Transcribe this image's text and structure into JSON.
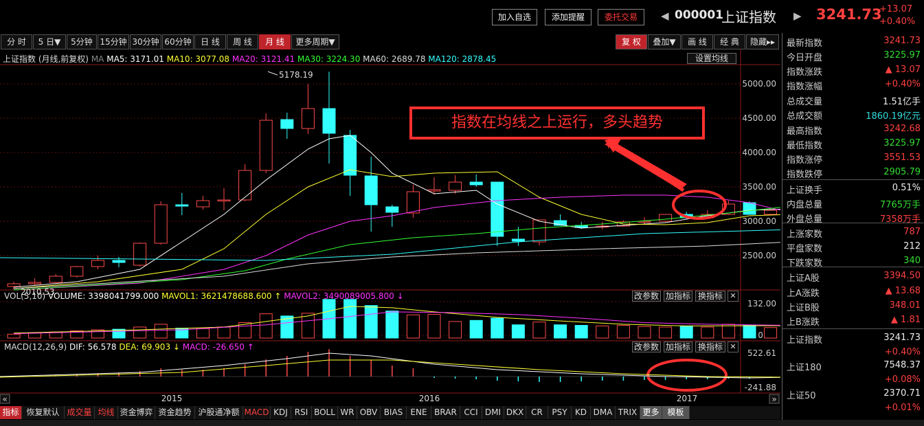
{
  "top": {
    "buttons": [
      "加入自选",
      "添加提醒",
      "委托交易"
    ],
    "code": "000001",
    "name": "上证指数",
    "price": "3241.73",
    "change": "+13.07",
    "change_pct": "+0.40%"
  },
  "periods": [
    "分 时",
    "5 日▼",
    "5分钟",
    "15分钟",
    "30分钟",
    "60分钟",
    "日 线",
    "周 线",
    "月 线",
    "更多周期▼"
  ],
  "active_period": "月 线",
  "right_tools": [
    "复 权",
    "叠加▼",
    "画 线",
    "经 典",
    "隐藏▸▸"
  ],
  "main_legend": {
    "title": "上证指数 (月线,前复权)",
    "ma": "MA",
    "ma5": "MA5: 3171.01",
    "ma10": "MA10: 3077.08",
    "ma20": "MA20: 3121.41",
    "ma30": "MA30: 3224.30",
    "ma60": "MA60: 2689.78",
    "ma120": "MA120: 2878.45",
    "setting": "设置均线"
  },
  "annotation": "指数在均线之上运行，多头趋势",
  "high_label": "5178.19",
  "low_label": "2010.53",
  "vol_legend": {
    "name": "VOL(5,10)",
    "volume": "VOLUME: 3398041799.000",
    "mavol1": "MAVOL1: 3621478688.600",
    "mavol2": "MAVOL2: 3490089005.800"
  },
  "macd_legend": {
    "name": "MACD(12,26,9)",
    "dif": "DIF: 56.578",
    "dea": "DEA: 69.903",
    "macd": "MACD: -26.650"
  },
  "panel_buttons": [
    "改参数",
    "加指标",
    "换指标",
    "✕"
  ],
  "x_labels": [
    "2015",
    "2016",
    "2017"
  ],
  "y_main": [
    "5000.00",
    "4500.00",
    "4000.00",
    "3500.00",
    "3000.00",
    "2500.00"
  ],
  "y_vol": [
    "132.00",
    "0.00"
  ],
  "y_macd": [
    "522.61",
    "-241.88"
  ],
  "right_panel": [
    {
      "label": "最新指数",
      "value": "3241.73",
      "color": "red"
    },
    {
      "label": "今日开盘",
      "value": "3225.97",
      "color": "green"
    },
    {
      "label": "指数涨跌",
      "value": "▲ 13.07",
      "color": "red"
    },
    {
      "label": "指数涨幅",
      "value": "+0.40%",
      "color": "red"
    },
    {
      "label": "总成交量",
      "value": "1.51亿手",
      "color": "white"
    },
    {
      "label": "总成交额",
      "value": "1860.19亿元",
      "color": "cyan"
    },
    {
      "label": "最高指数",
      "value": "3242.68",
      "color": "red"
    },
    {
      "label": "最低指数",
      "value": "3225.97",
      "color": "green"
    },
    {
      "label": "指数涨停",
      "value": "3551.53",
      "color": "red"
    },
    {
      "label": "指数跌停",
      "value": "2905.79",
      "color": "green"
    },
    {
      "label": "上证换手",
      "value": "0.51%",
      "color": "white"
    },
    {
      "label": "内盘总量",
      "value": "7765万手",
      "color": "green"
    },
    {
      "label": "外盘总量",
      "value": "7358万手",
      "color": "red"
    },
    {
      "label": "上涨家数",
      "value": "787",
      "color": "red"
    },
    {
      "label": "平盘家数",
      "value": "212",
      "color": "white"
    },
    {
      "label": "下跌家数",
      "value": "340",
      "color": "green"
    },
    {
      "label": "上证A股",
      "value": "3394.50",
      "color": "red"
    },
    {
      "label": "上A涨跌",
      "value": "▲ 13.68",
      "color": "red"
    },
    {
      "label": "上证B股",
      "value": "348.01",
      "color": "red"
    },
    {
      "label": "上B涨跌",
      "value": "▲ 1.81",
      "color": "red"
    },
    {
      "label": "上证指数",
      "value": "3241.73",
      "color": "white"
    },
    {
      "label": "",
      "value": "+0.40%",
      "color": "red"
    },
    {
      "label": "上证180",
      "value": "7548.37",
      "color": "white"
    },
    {
      "label": "",
      "value": "+0.08%",
      "color": "red"
    },
    {
      "label": "上证50",
      "value": "2370.71",
      "color": "white"
    },
    {
      "label": "",
      "value": "+0.01%",
      "color": "red"
    }
  ],
  "bottom_tabs": [
    "指标",
    "恢复默认",
    "成交量",
    "均线",
    "资金博弈",
    "资金趋势",
    "沪股通净额",
    "MACD",
    "KDJ",
    "RSI",
    "BOLL",
    "WR",
    "OBV",
    "BIAS",
    "ENE",
    "BRAR",
    "CCI",
    "DMI",
    "DKX",
    "CR",
    "PSY",
    "KD",
    "DMA",
    "TRIX",
    "更多",
    "模板"
  ]
}
